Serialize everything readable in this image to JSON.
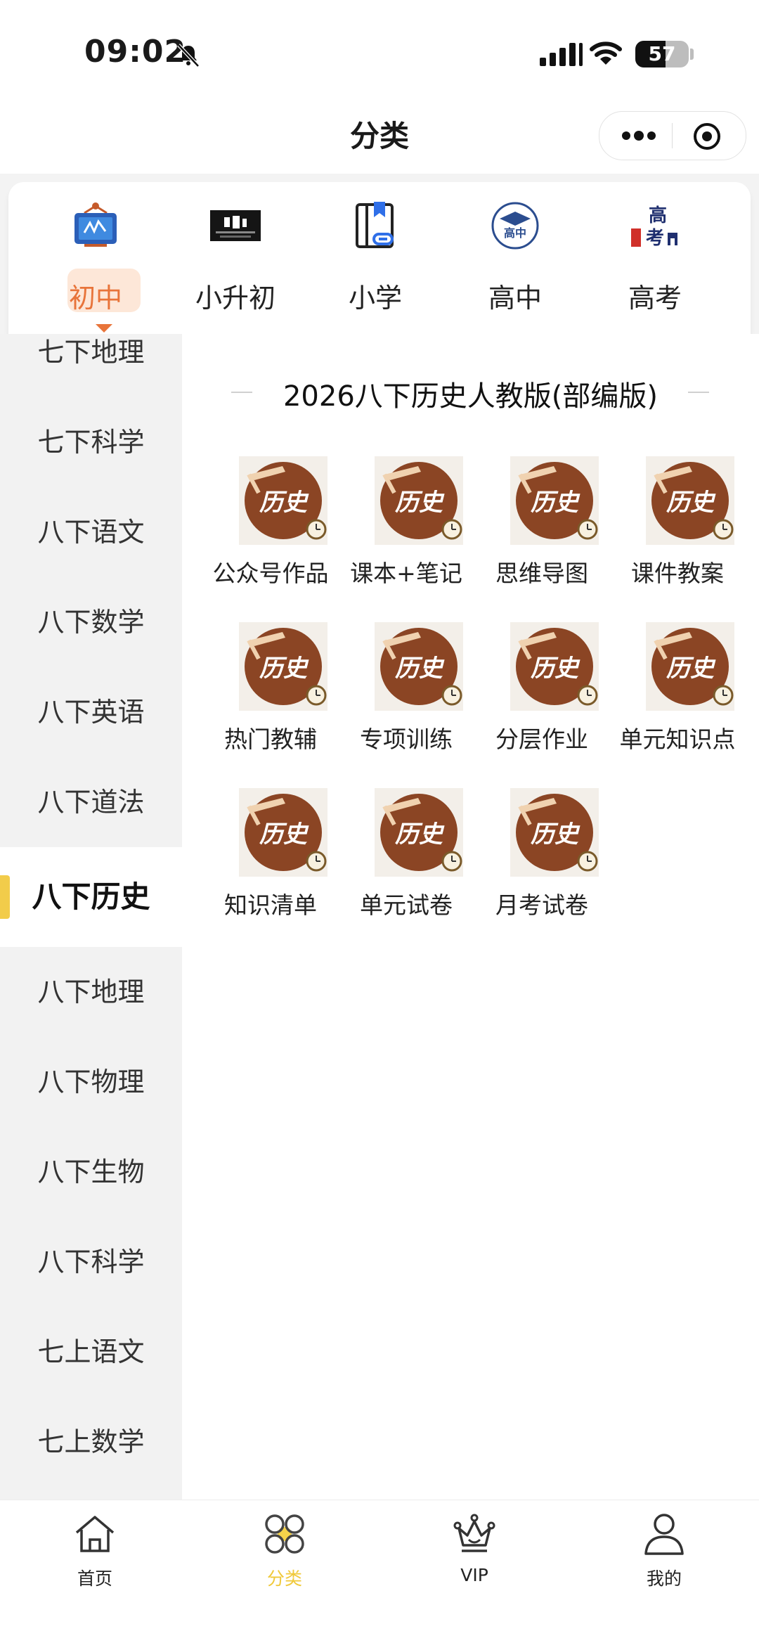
{
  "status_bar": {
    "time": "09:02",
    "battery": "57",
    "battery_level": 0.57
  },
  "nav": {
    "title": "分类"
  },
  "levels": [
    {
      "label": "初中",
      "active": true
    },
    {
      "label": "小升初",
      "active": false
    },
    {
      "label": "小学",
      "active": false
    },
    {
      "label": "高中",
      "active": false
    },
    {
      "label": "高考",
      "active": false
    }
  ],
  "level_icon_text": {
    "high_school": "高中",
    "gaokao": "高考"
  },
  "sidebar": {
    "items": [
      "七下地理",
      "七下科学",
      "八下语文",
      "八下数学",
      "八下英语",
      "八下道法",
      "八下历史",
      "八下地理",
      "八下物理",
      "八下生物",
      "八下科学",
      "七上语文",
      "七上数学"
    ],
    "active_index": 6
  },
  "content": {
    "title": "2026八下历史人教版(部编版)",
    "icon_text": "历史",
    "items": [
      "公众号作品",
      "课本+笔记",
      "思维导图",
      "课件教案",
      "热门教辅",
      "专项训练",
      "分层作业",
      "单元知识点",
      "知识清单",
      "单元试卷",
      "月考试卷"
    ]
  },
  "tabbar": {
    "items": [
      {
        "label": "首页",
        "icon": "home-icon",
        "active": false
      },
      {
        "label": "分类",
        "icon": "category-icon",
        "active": true
      },
      {
        "label": "VIP",
        "icon": "crown-icon",
        "active": false
      },
      {
        "label": "我的",
        "icon": "user-icon",
        "active": false
      }
    ]
  },
  "colors": {
    "accent_orange": "#e8743a",
    "accent_yellow": "#f0c93a",
    "history_brown": "#8b4524"
  }
}
